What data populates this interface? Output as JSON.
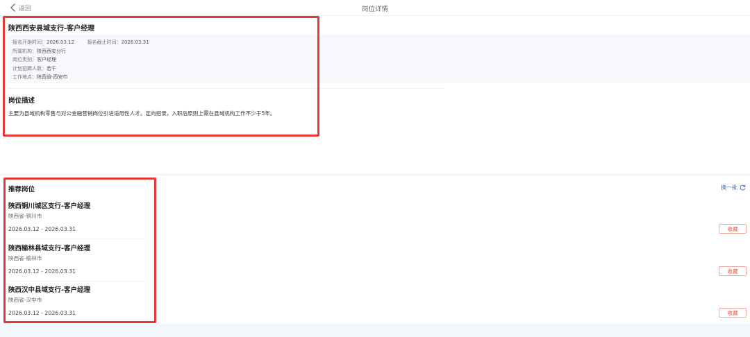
{
  "header": {
    "back_label": "返回",
    "title": "岗位详情"
  },
  "job": {
    "title": "陕西西安县域支行-客户经理",
    "info": {
      "start_label": "报名开始时间：",
      "start_value": "2026.03.12",
      "end_label": "报名截止时间：",
      "end_value": "2026.03.31",
      "org_label": "所属机构：",
      "org_value": "陕西西安分行",
      "category_label": "岗位类别：",
      "category_value": "客户经理",
      "headcount_label": "计划招聘人数：",
      "headcount_value": "若干",
      "location_label": "工作地点：",
      "location_value": "陕西省-西安市"
    },
    "description_heading": "岗位描述",
    "description": "主要为县域机构零售与对公金融营销岗位引进适用性人才。定向招录，入职后原则上需在县域机构工作不少于5年。"
  },
  "recommended": {
    "heading": "推荐岗位",
    "refresh_label": "换一批",
    "items": [
      {
        "title": "陕西铜川城区支行-客户经理",
        "location": "陕西省-铜川市",
        "dates": "2026.03.12 - 2026.03.31",
        "fav_label": "收藏"
      },
      {
        "title": "陕西榆林县域支行-客户经理",
        "location": "陕西省-榆林市",
        "dates": "2026.03.12 - 2026.03.31",
        "fav_label": "收藏"
      },
      {
        "title": "陕西汉中县域支行-客户经理",
        "location": "陕西省-汉中市",
        "dates": "2026.03.12 - 2026.03.31",
        "fav_label": "收藏"
      }
    ]
  },
  "colors": {
    "highlight": "#e53935",
    "link": "#3b6fd8",
    "favorite": "#e0533b"
  }
}
